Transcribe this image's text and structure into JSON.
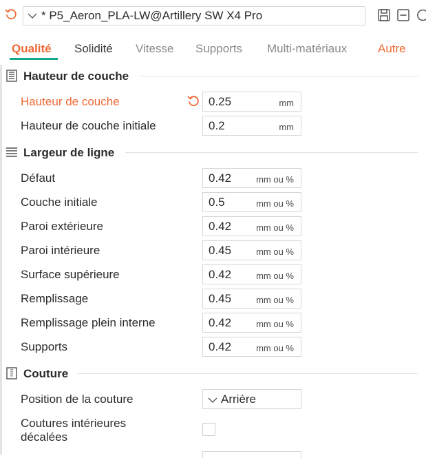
{
  "header": {
    "preset_name": "* P5_Aeron_PLA-LW@Artillery SW X4 Pro"
  },
  "tabs": [
    {
      "label": "Qualité",
      "active": true
    },
    {
      "label": "Solidité"
    },
    {
      "label": "Vitesse"
    },
    {
      "label": "Supports"
    },
    {
      "label": "Multi-matériaux"
    },
    {
      "label": "Autre"
    }
  ],
  "colors": {
    "accent": "#ef6a37",
    "tab_underline": "#13a98a"
  },
  "sections": [
    {
      "title": "Hauteur de couche",
      "rows": [
        {
          "label": "Hauteur de couche",
          "value": "0.25",
          "unit": "mm",
          "modified": true
        },
        {
          "label": "Hauteur de couche initiale",
          "value": "0.2",
          "unit": "mm"
        }
      ]
    },
    {
      "title": "Largeur de ligne",
      "rows": [
        {
          "label": "Défaut",
          "value": "0.42",
          "unit": "mm ou %"
        },
        {
          "label": "Couche initiale",
          "value": "0.5",
          "unit": "mm ou %"
        },
        {
          "label": "Paroi extérieure",
          "value": "0.42",
          "unit": "mm ou %"
        },
        {
          "label": "Paroi intérieure",
          "value": "0.45",
          "unit": "mm ou %"
        },
        {
          "label": "Surface supérieure",
          "value": "0.42",
          "unit": "mm ou %"
        },
        {
          "label": "Remplissage",
          "value": "0.45",
          "unit": "mm ou %"
        },
        {
          "label": "Remplissage plein interne",
          "value": "0.42",
          "unit": "mm ou %"
        },
        {
          "label": "Supports",
          "value": "0.42",
          "unit": "mm ou %"
        }
      ]
    },
    {
      "title": "Couture",
      "rows": [
        {
          "label": "Position de la couture",
          "value": "Arrière"
        },
        {
          "label_line1": "Coutures intérieures",
          "label_line2": "décalées",
          "checked": false
        }
      ]
    }
  ]
}
